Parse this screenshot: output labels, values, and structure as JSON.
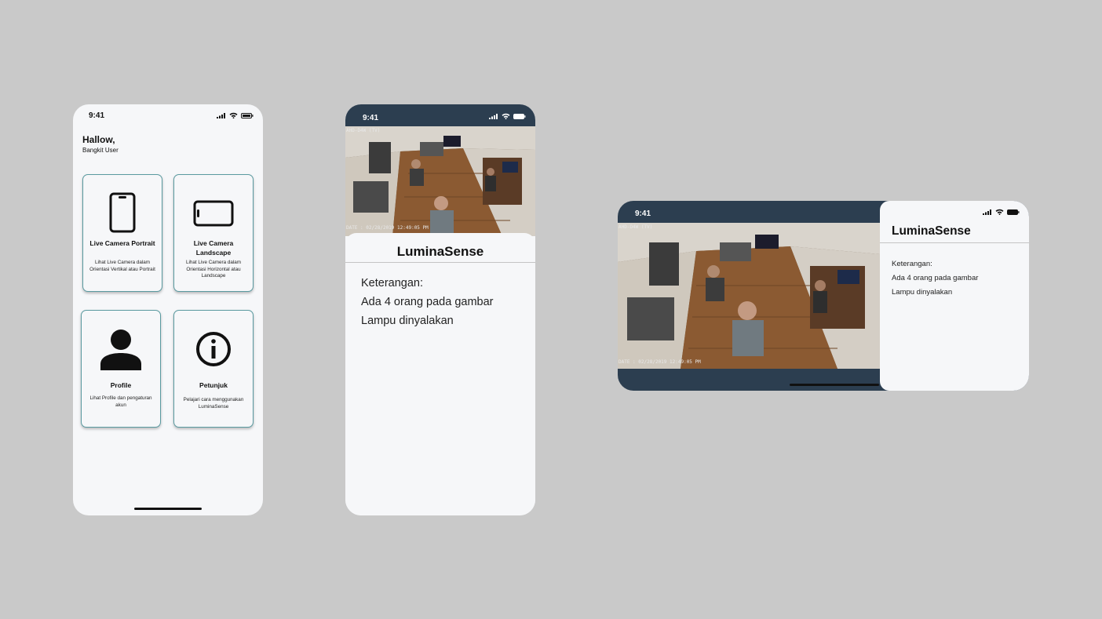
{
  "status": {
    "time": "9:41"
  },
  "home": {
    "greeting": "Hallow,",
    "username": "Bangkit User",
    "cards": [
      {
        "title": "Live Camera Portrait",
        "desc": "Lihat Live Camera dalam Orientasi Vertikal atau Portrait",
        "icon": "phone-portrait-icon"
      },
      {
        "title": "Live Camera Landscape",
        "desc": "Lihat Live Camera dalam Orientasi Horizontal atau Landscape",
        "icon": "phone-landscape-icon"
      },
      {
        "title": "Profile",
        "desc": "Lihat Profile dan pengaturan akun",
        "icon": "person-icon"
      },
      {
        "title": "Petunjuk",
        "desc": "Pelajari cara menggunakan LuminaSense",
        "icon": "info-icon"
      }
    ]
  },
  "camera": {
    "brand": "LuminaSense",
    "info_label": "Keterangan:",
    "info_people": "Ada 4 orang pada gambar",
    "info_lamp": "Lampu dinyalakan",
    "overlay_channel": "AHD-D4W (TV)",
    "overlay_date": "DATE : 02/28/2019 12:49:05 PM"
  },
  "colors": {
    "accent": "#2c3e50",
    "card_border": "#5a9aa0",
    "background": "#c9c9c9"
  }
}
